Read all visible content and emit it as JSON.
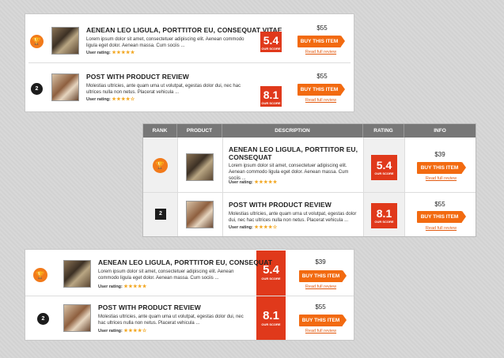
{
  "common": {
    "title_1": "AENEAN LEO LIGULA, PORTTITOR EU, CONSEQUAT VITAE",
    "title_1_short": "AENEAN LEO LIGULA, PORTTITOR EU, CONSEQUAT",
    "title_2": "POST WITH PRODUCT REVIEW",
    "desc_1a": "Lorem ipsum dolor sit amet, consectetuer adipiscing elit. Aenean commodo ligula eget dolor. Aenean massa. Cum sociis ...",
    "desc_1b": "Lorem ipsum dolor sit amet, consectetuer adipiscing elit. Aenean commodo ligula eget dolor. Aenean massa. Cum sociis ...",
    "desc_2a": "Molestias ultricies, ante quam uma ut volutpat, egestas dolor dui, nec hac ultrices nulla non netus. Placerat vehicula ...",
    "desc_2b": "Molestias ultricies, ante quam urna ut volutpat, egestas dolor dui, nec hac ultrices nulla non netus. Placerat vehicula ...",
    "user_rating": "User rating:",
    "our_score": "OUR SCORE",
    "buy": "BUY THIS ITEM",
    "review": "Read full review",
    "rank_2": "2"
  },
  "list1": {
    "items": [
      {
        "score": "5.4",
        "price": "$55",
        "stars": "★★★★★"
      },
      {
        "score": "8.1",
        "price": "$55",
        "stars": "★★★★☆"
      }
    ]
  },
  "table": {
    "headers": [
      "RANK",
      "PRODUCT",
      "DESCRIPTION",
      "RATING",
      "INFO"
    ],
    "items": [
      {
        "score": "5.4",
        "price": "$39",
        "stars": "★★★★★"
      },
      {
        "score": "8.1",
        "price": "$55",
        "stars": "★★★★☆"
      }
    ]
  },
  "list3": {
    "items": [
      {
        "score": "5.4",
        "price": "$39",
        "stars": "★★★★★"
      },
      {
        "score": "8.1",
        "price": "$55",
        "stars": "★★★★☆"
      }
    ]
  },
  "colors": {
    "accent": "#f26a10",
    "score_red": "#e0391b"
  },
  "icons": {
    "rank_1": "trophy-icon"
  }
}
